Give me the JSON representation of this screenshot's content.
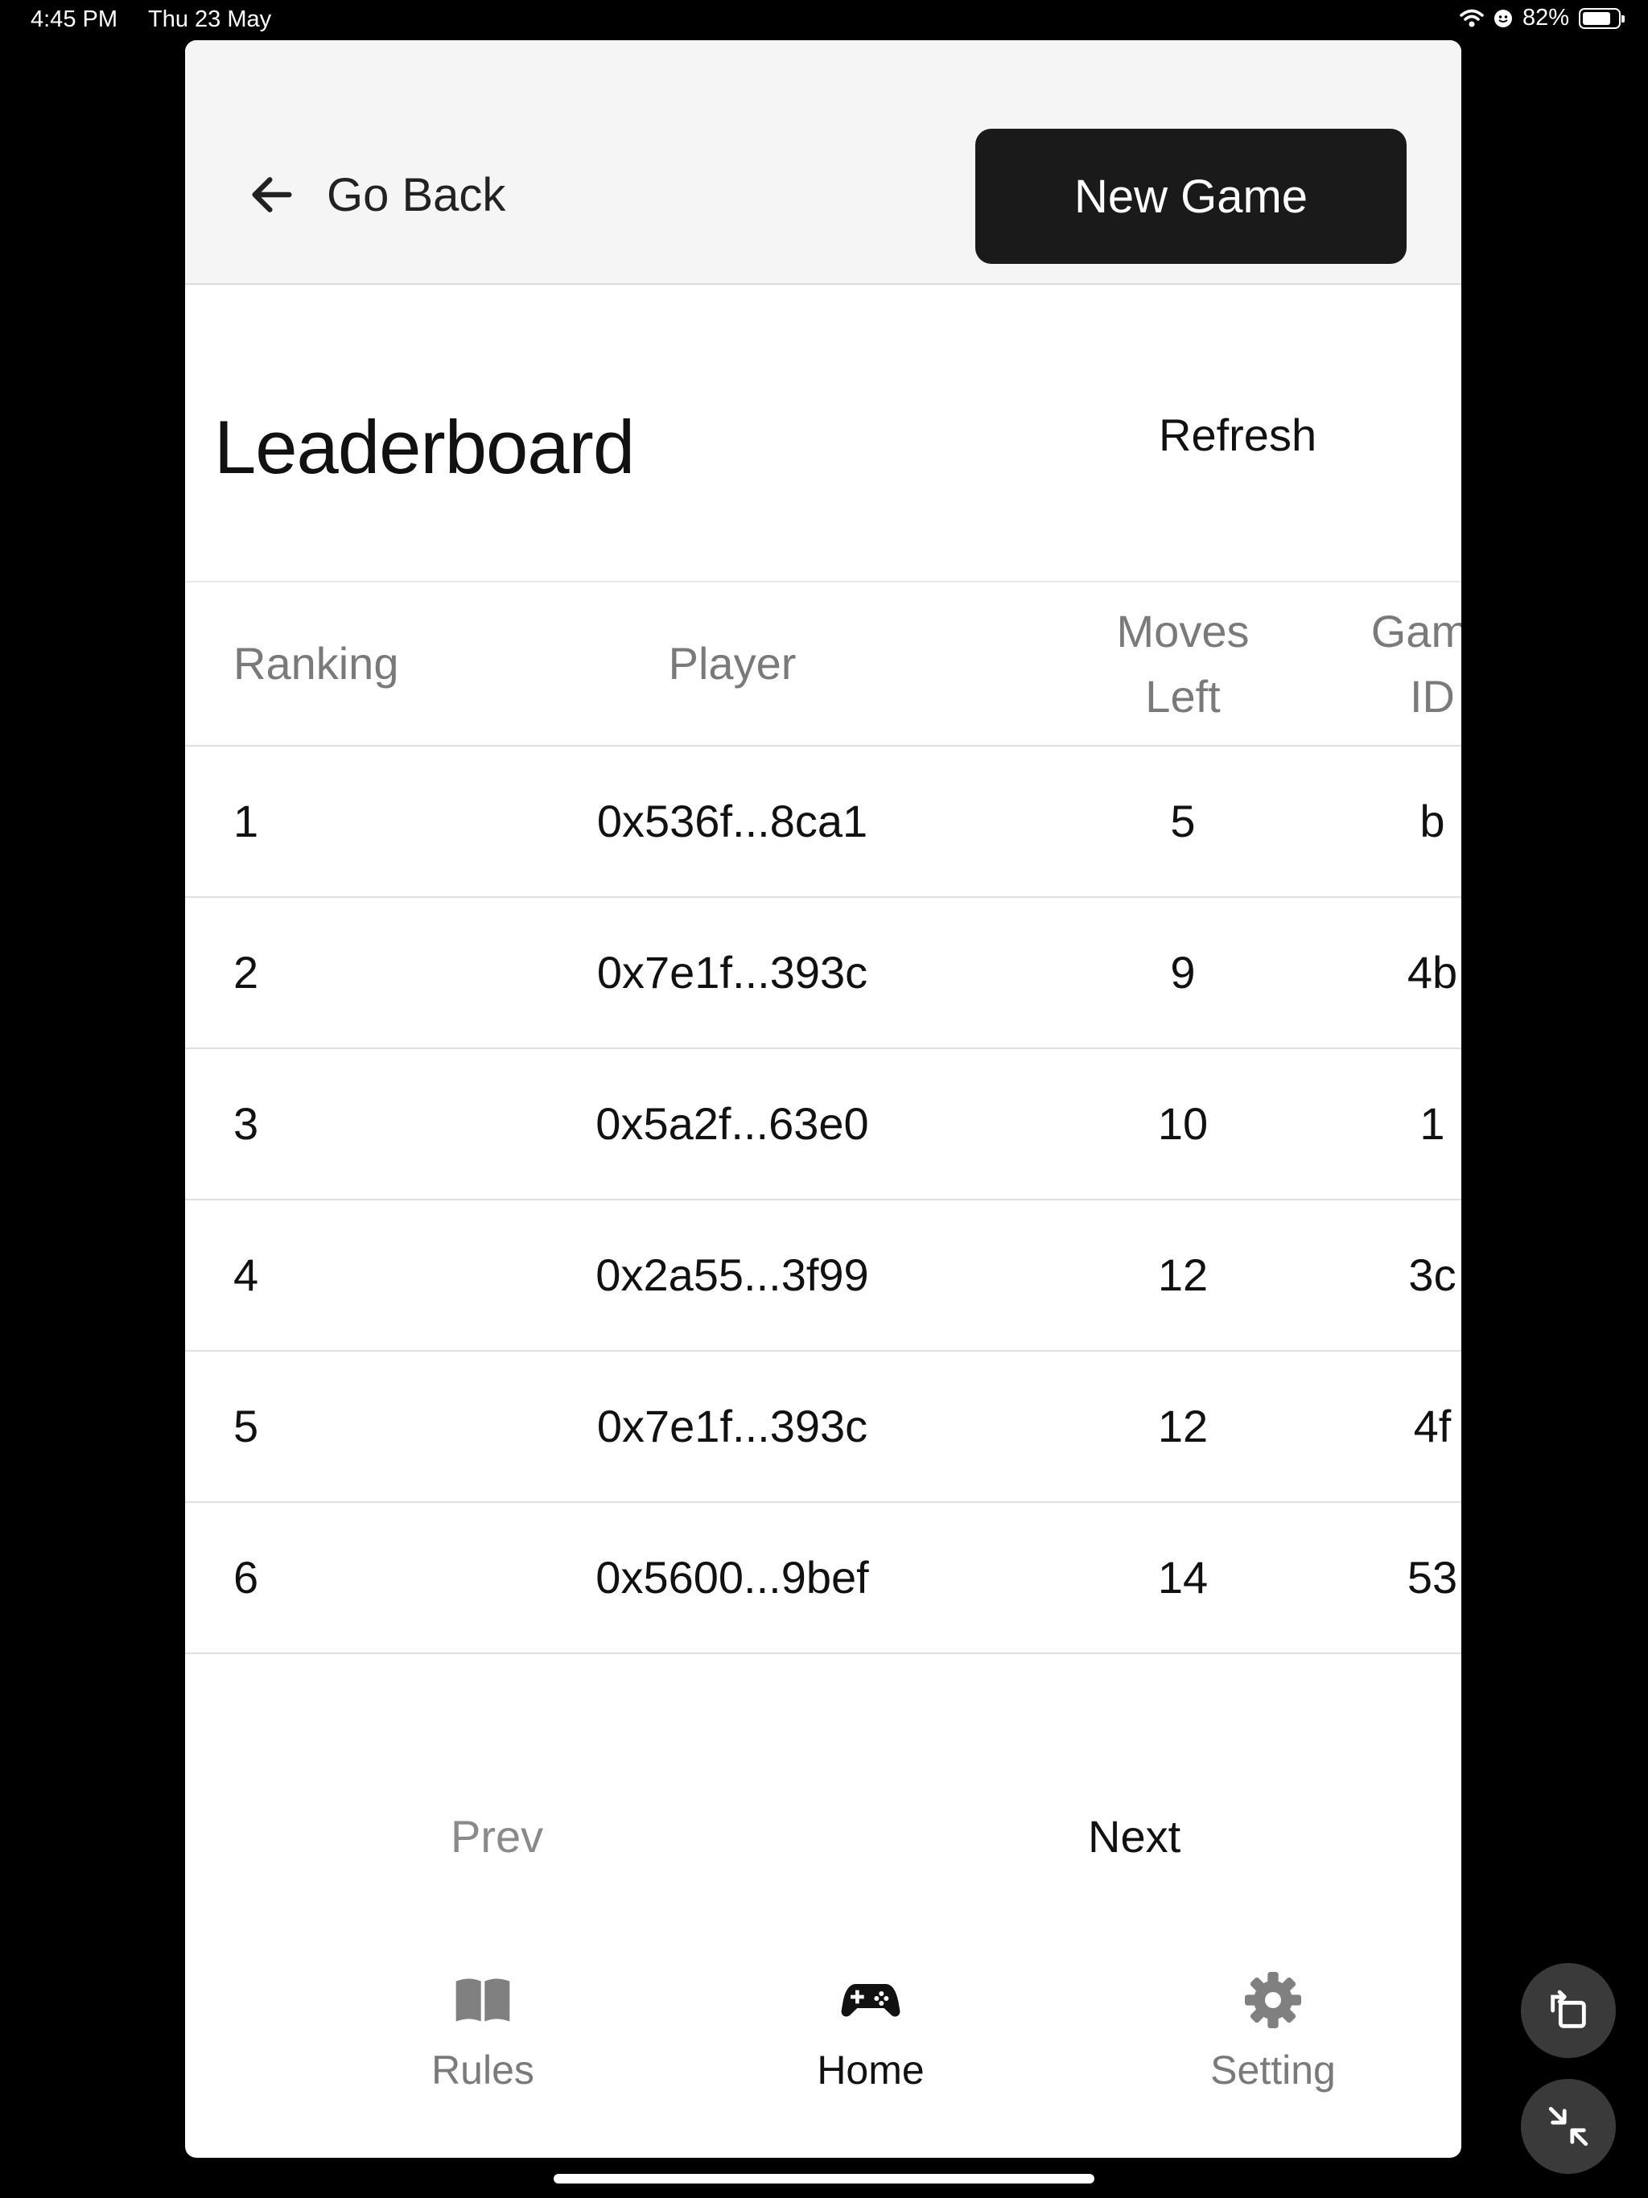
{
  "status_bar": {
    "time": "4:45 PM",
    "date": "Thu 23 May",
    "battery": "82%"
  },
  "header": {
    "back_label": "Go Back",
    "new_game_label": "New Game"
  },
  "page": {
    "title": "Leaderboard",
    "refresh_label": "Refresh"
  },
  "table": {
    "headers": {
      "ranking": "Ranking",
      "player": "Player",
      "moves_left_line1": "Moves",
      "moves_left_line2": "Left",
      "game_id_line1": "Game",
      "game_id_line2": "ID"
    },
    "rows": [
      {
        "rank": "1",
        "player": "0x536f...8ca1",
        "moves": "5",
        "game_id": "b"
      },
      {
        "rank": "2",
        "player": "0x7e1f...393c",
        "moves": "9",
        "game_id": "4b"
      },
      {
        "rank": "3",
        "player": "0x5a2f...63e0",
        "moves": "10",
        "game_id": "1"
      },
      {
        "rank": "4",
        "player": "0x2a55...3f99",
        "moves": "12",
        "game_id": "3c"
      },
      {
        "rank": "5",
        "player": "0x7e1f...393c",
        "moves": "12",
        "game_id": "4f"
      },
      {
        "rank": "6",
        "player": "0x5600...9bef",
        "moves": "14",
        "game_id": "53"
      }
    ]
  },
  "pagination": {
    "prev_label": "Prev",
    "next_label": "Next"
  },
  "tabbar": {
    "rules": {
      "label": "Rules",
      "icon": "book-icon"
    },
    "home": {
      "label": "Home",
      "icon": "gamepad-icon"
    },
    "setting": {
      "label": "Setting",
      "icon": "gear-icon"
    }
  },
  "colors": {
    "primary_button": "#1a1a1a",
    "header_bg": "#f5f5f5",
    "muted_text": "#7a7a7a"
  }
}
